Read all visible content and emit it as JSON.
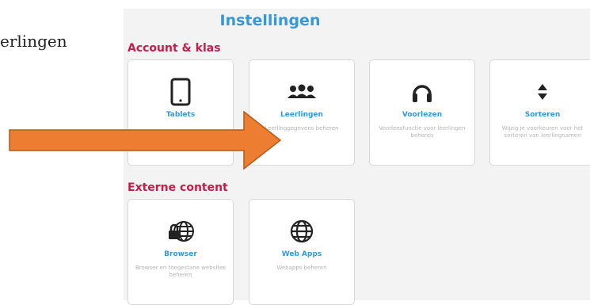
{
  "left_fragment": "erlingen",
  "panel": {
    "title": "Instellingen",
    "sections": [
      {
        "title": "Account & klas",
        "cards": [
          {
            "name": "Tablets",
            "desc": "",
            "icon": "tablet-icon"
          },
          {
            "name": "Leerlingen",
            "desc": "Leerlinggegevens beheren",
            "icon": "users-icon"
          },
          {
            "name": "Voorlezen",
            "desc": "Voorleesfunctie voor leerlingen beheren",
            "icon": "headphones-icon"
          },
          {
            "name": "Sorteren",
            "desc": "Wijzig je voorkeuren voor het sorteren van leerlingnamen",
            "icon": "sort-icon"
          }
        ]
      },
      {
        "title": "Externe content",
        "cards": [
          {
            "name": "Browser",
            "desc": "Browser en toegestane websites beheren",
            "icon": "globe-lock-icon"
          },
          {
            "name": "Web Apps",
            "desc": "Webapps beheren",
            "icon": "globe-icon"
          }
        ]
      }
    ]
  },
  "colors": {
    "accent": "#3498db",
    "section": "#c41e4a",
    "arrow": "#ed7d31",
    "arrow_border": "#b55a17"
  }
}
